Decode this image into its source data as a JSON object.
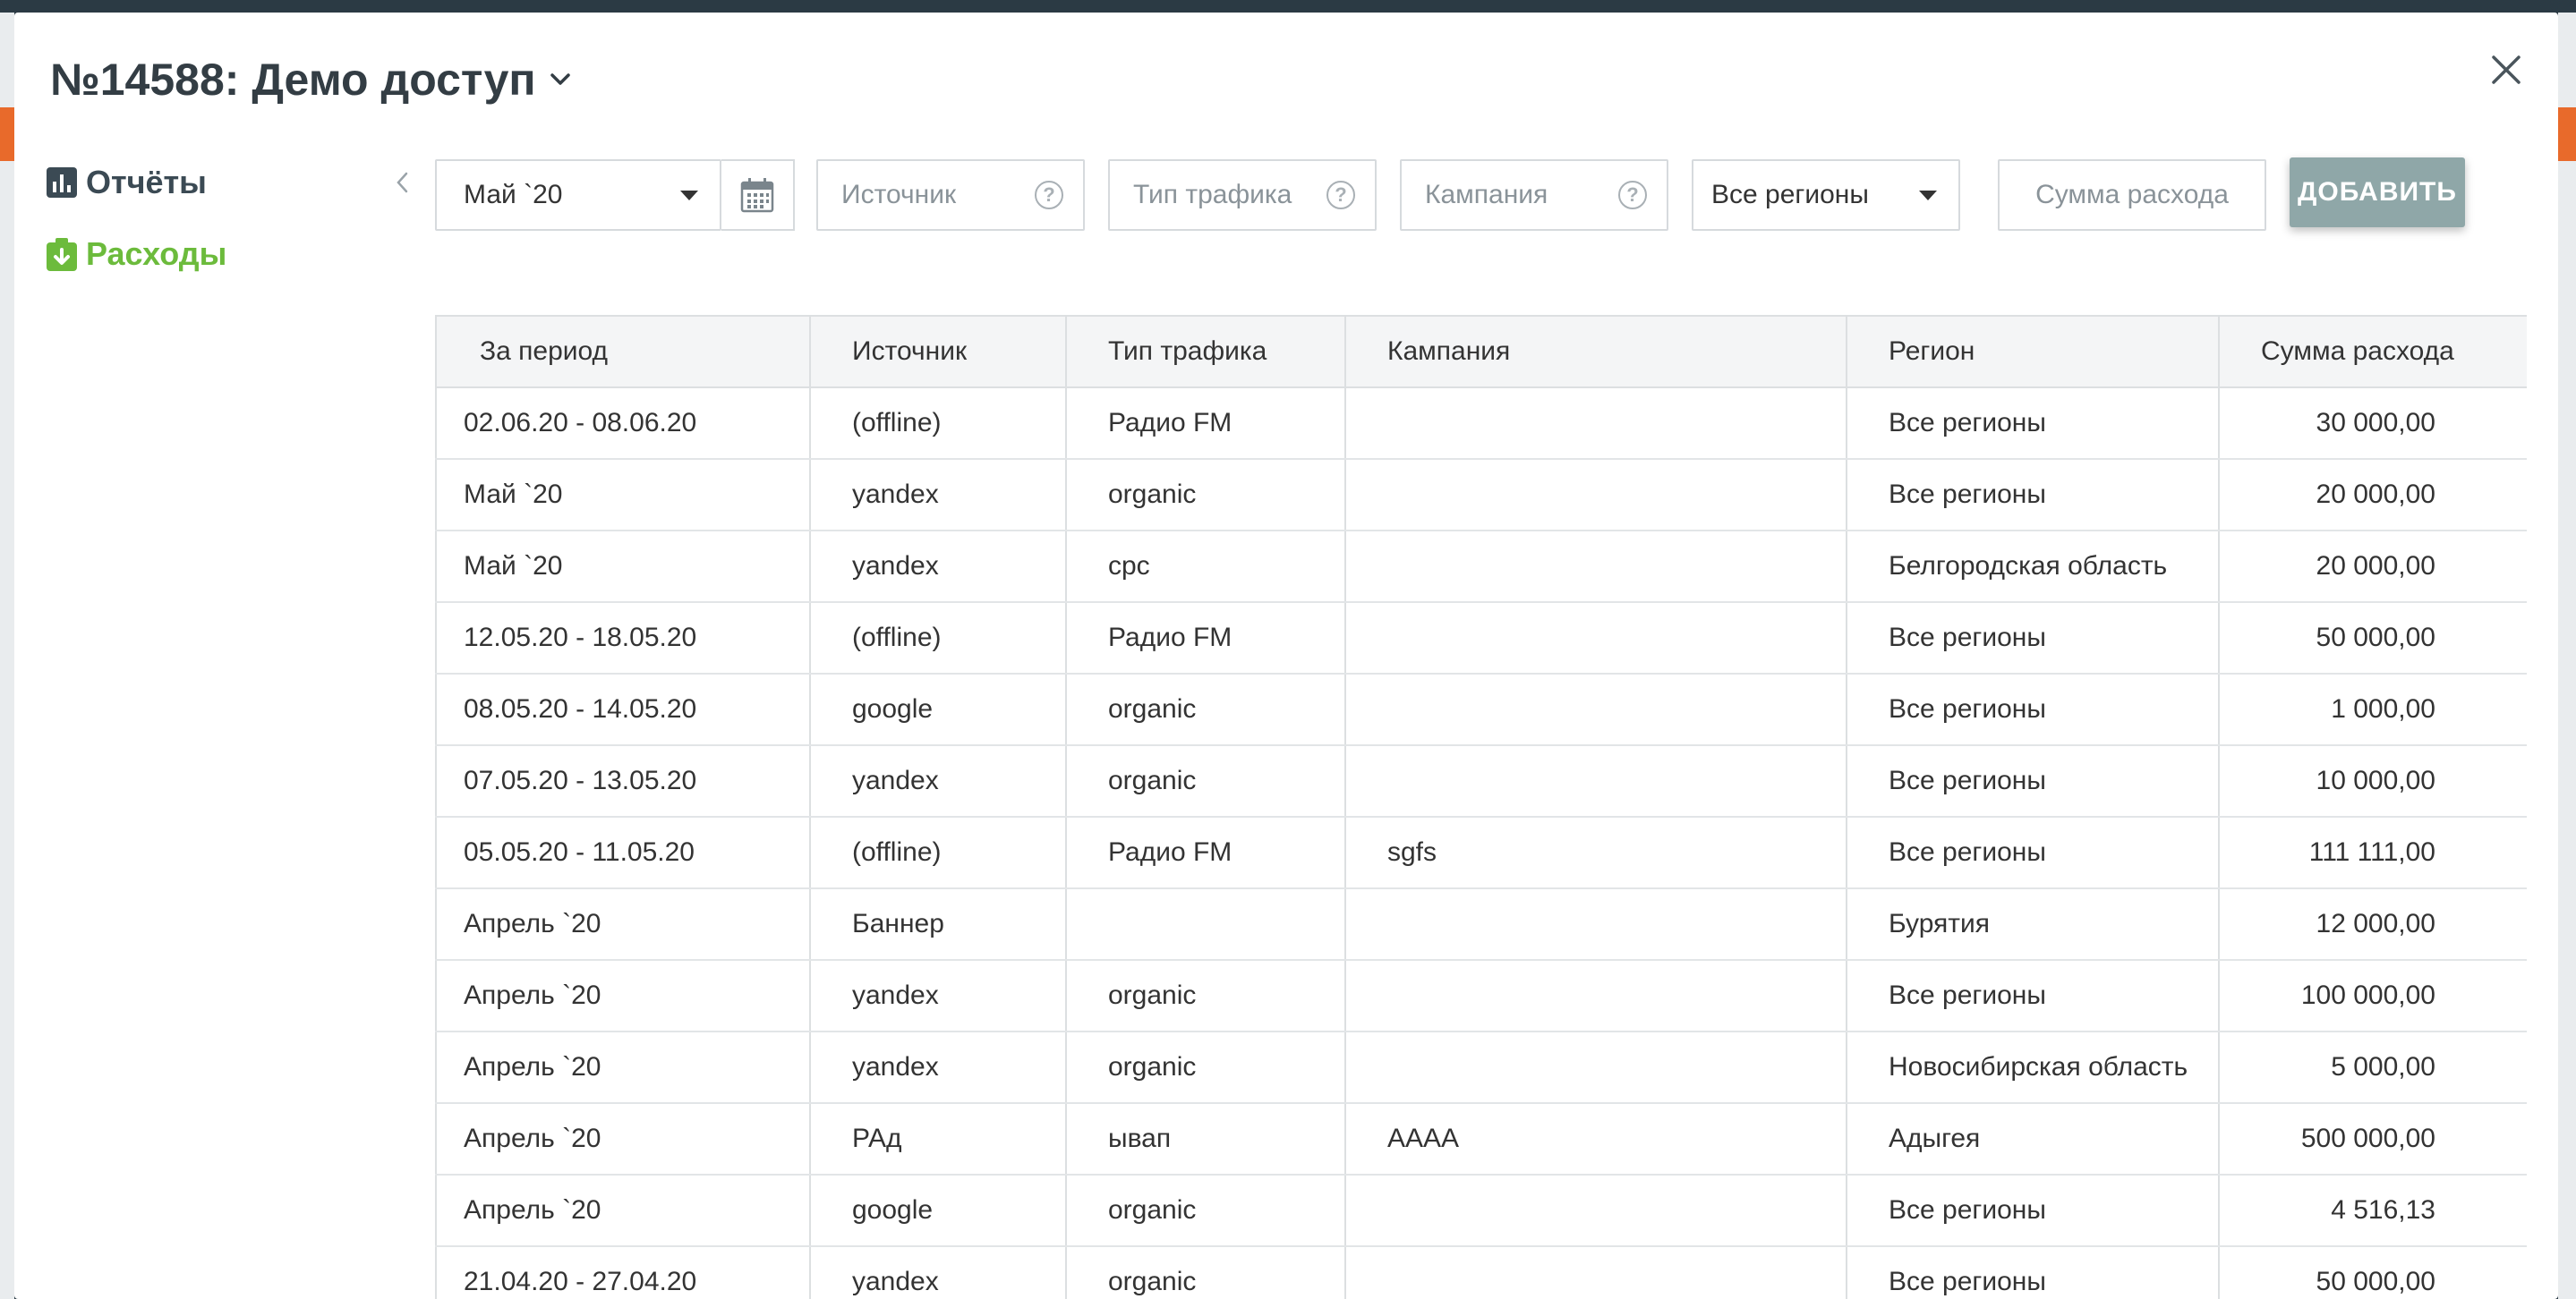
{
  "modal": {
    "title": "№14588: Демо доступ"
  },
  "sidebar": {
    "items": [
      {
        "label": "Отчёты",
        "icon": "bar-chart-icon"
      },
      {
        "label": "Расходы",
        "icon": "download-clipboard-icon"
      }
    ]
  },
  "filters": {
    "period_value": "Май `20",
    "source_placeholder": "Источник",
    "traffic_type_placeholder": "Тип трафика",
    "campaign_placeholder": "Кампания",
    "region_value": "Все регионы",
    "amount_placeholder": "Сумма расхода",
    "add_label": "ДОБАВИТЬ"
  },
  "table": {
    "headers": [
      "За период",
      "Источник",
      "Тип трафика",
      "Кампания",
      "Регион",
      "Сумма расхода"
    ],
    "rows": [
      [
        "02.06.20 - 08.06.20",
        "(offline)",
        "Радио FM",
        "",
        "Все регионы",
        "30 000,00"
      ],
      [
        "Май `20",
        "yandex",
        "organic",
        "",
        "Все регионы",
        "20 000,00"
      ],
      [
        "Май `20",
        "yandex",
        "cpc",
        "",
        "Белгородская область",
        "20 000,00"
      ],
      [
        "12.05.20 - 18.05.20",
        "(offline)",
        "Радио FM",
        "",
        "Все регионы",
        "50 000,00"
      ],
      [
        "08.05.20 - 14.05.20",
        "google",
        "organic",
        "",
        "Все регионы",
        "1 000,00"
      ],
      [
        "07.05.20 - 13.05.20",
        "yandex",
        "organic",
        "",
        "Все регионы",
        "10 000,00"
      ],
      [
        "05.05.20 - 11.05.20",
        "(offline)",
        "Радио FM",
        "sgfs",
        "Все регионы",
        "111 111,00"
      ],
      [
        "Апрель `20",
        "Баннер",
        "",
        "",
        "Бурятия",
        "12 000,00"
      ],
      [
        "Апрель `20",
        "yandex",
        "organic",
        "",
        "Все регионы",
        "100 000,00"
      ],
      [
        "Апрель `20",
        "yandex",
        "organic",
        "",
        "Новосибирская область",
        "5 000,00"
      ],
      [
        "Апрель `20",
        "РАд",
        "ывап",
        "АААА",
        "Адыгея",
        "500 000,00"
      ],
      [
        "Апрель `20",
        "google",
        "organic",
        "",
        "Все регионы",
        "4 516,13"
      ],
      [
        "21.04.20 - 27.04.20",
        "yandex",
        "organic",
        "",
        "Все регионы",
        "50 000,00"
      ]
    ]
  },
  "colors": {
    "reports": "#3b4a54",
    "costs": "#6cbb3c",
    "add_button": "#8fa7a8"
  }
}
